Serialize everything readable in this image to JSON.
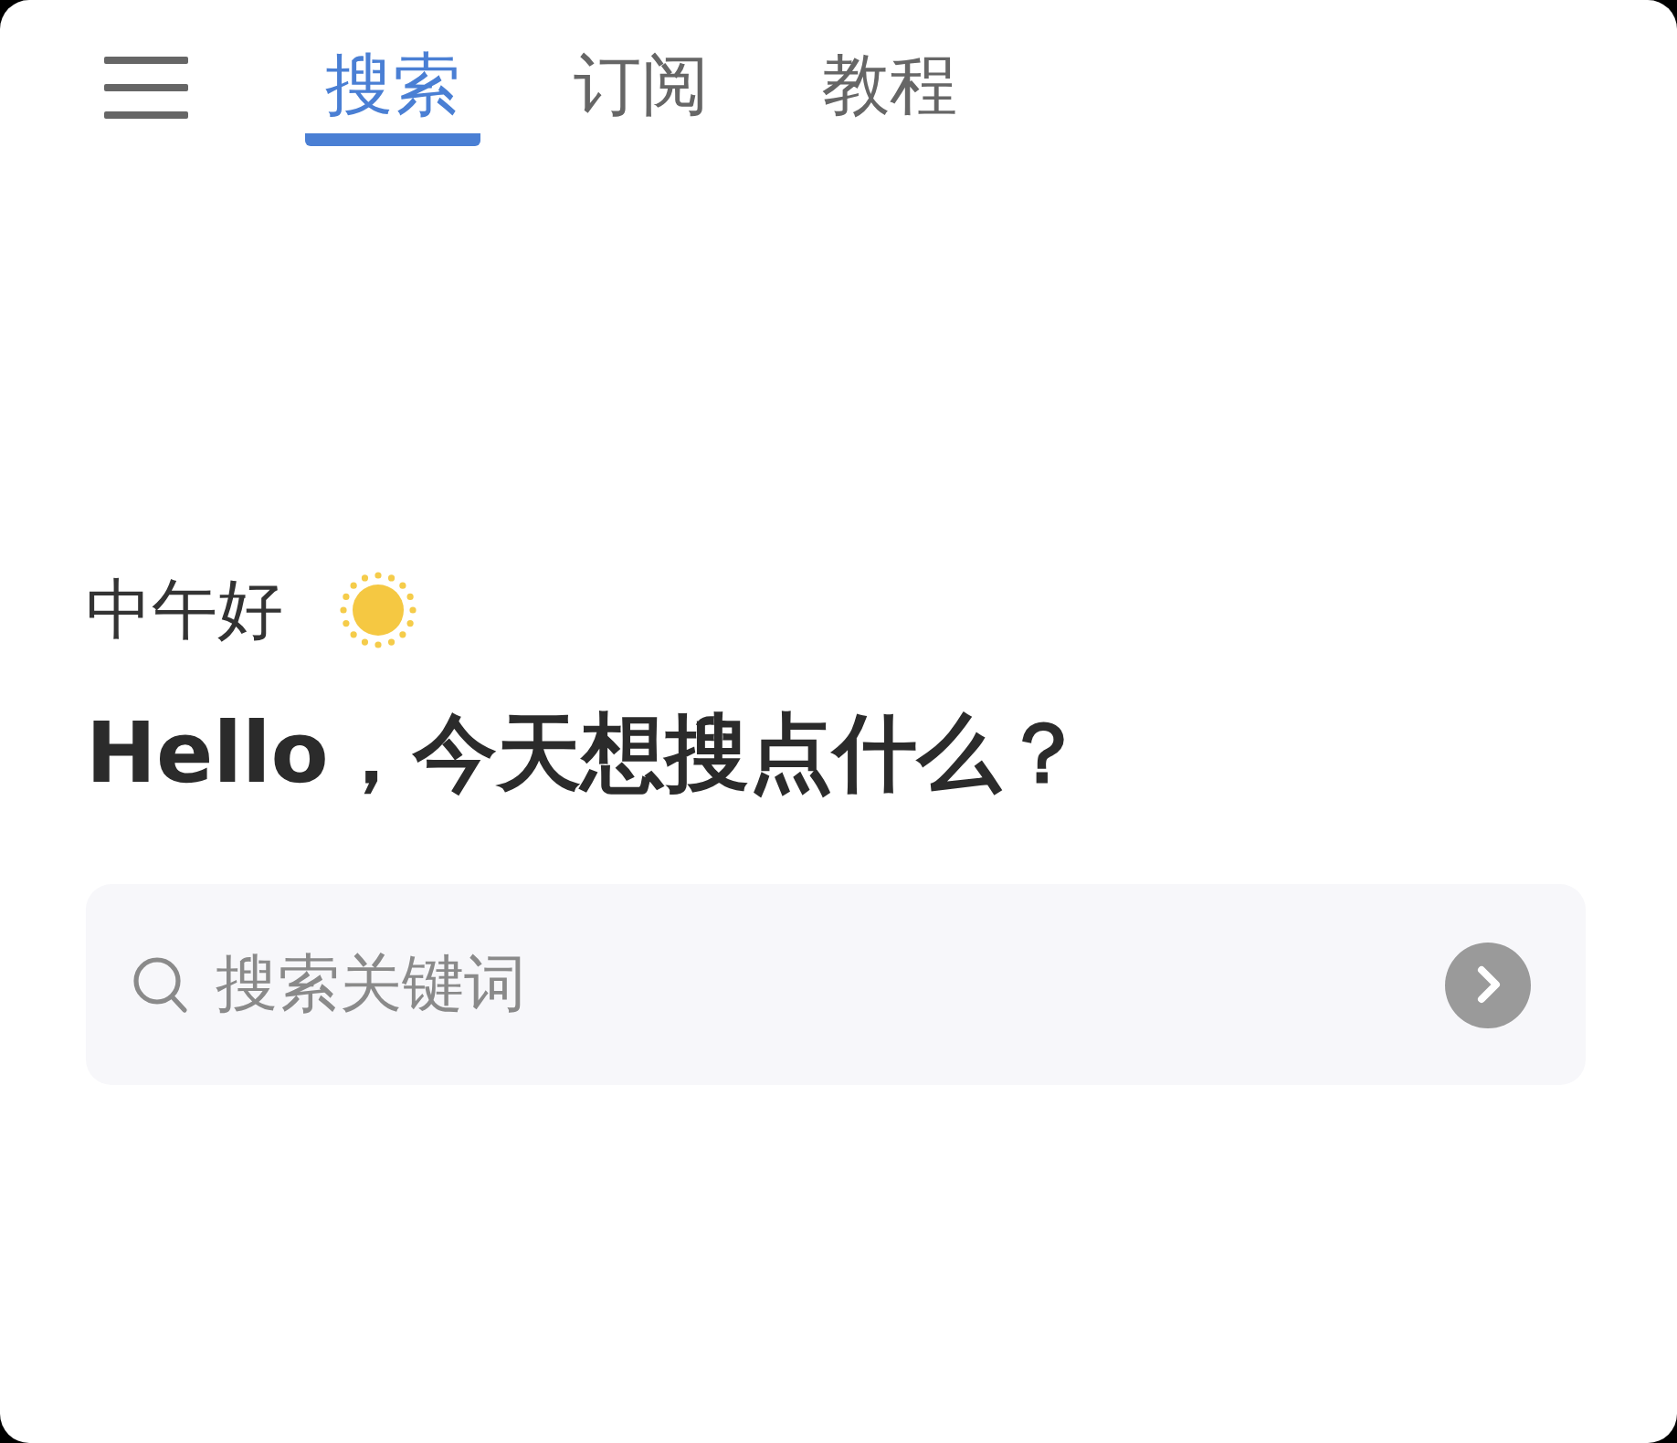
{
  "nav": {
    "tabs": [
      {
        "label": "搜索",
        "selected": true
      },
      {
        "label": "订阅",
        "selected": false
      },
      {
        "label": "教程",
        "selected": false
      }
    ]
  },
  "greeting": {
    "text": "中午好"
  },
  "headline": "Hello，今天想搜点什么？",
  "search": {
    "placeholder": "搜索关键词"
  }
}
